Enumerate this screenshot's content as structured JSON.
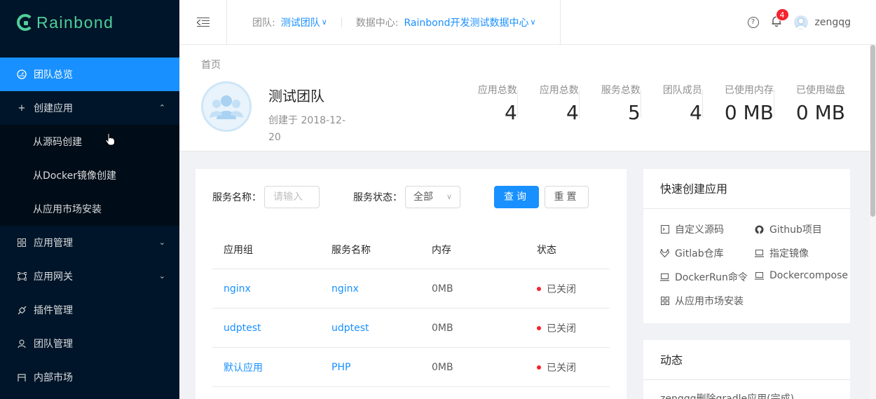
{
  "brand": {
    "name": "Rainbond"
  },
  "sidebar": {
    "items": [
      {
        "label": "团队总览",
        "icon": "dashboard-icon"
      },
      {
        "label": "创建应用",
        "icon": "plus-icon"
      },
      {
        "label": "从源码创建"
      },
      {
        "label": "从Docker镜像创建"
      },
      {
        "label": "从应用市场安装"
      },
      {
        "label": "应用管理",
        "icon": "appstore-icon"
      },
      {
        "label": "应用网关",
        "icon": "gateway-icon"
      },
      {
        "label": "插件管理",
        "icon": "api-icon"
      },
      {
        "label": "团队管理",
        "icon": "team-icon"
      },
      {
        "label": "内部市场",
        "icon": "shop-icon"
      }
    ]
  },
  "header": {
    "team_label": "团队:",
    "team_value": "测试团队",
    "dc_label": "数据中心:",
    "dc_value": "Rainbond开发测试数据中心",
    "notification_count": "4",
    "username": "zengqg"
  },
  "page": {
    "breadcrumb": "首页",
    "team_name": "测试团队",
    "created_text": "创建于 2018-12-20",
    "stats": [
      {
        "label": "应用总数",
        "value": "4"
      },
      {
        "label": "应用总数",
        "value": "4"
      },
      {
        "label": "服务总数",
        "value": "5"
      },
      {
        "label": "团队成员",
        "value": "4"
      },
      {
        "label": "已使用内存",
        "value": "0 MB"
      },
      {
        "label": "已使用磁盘",
        "value": "0 MB"
      }
    ]
  },
  "filter": {
    "name_label": "服务名称：",
    "name_placeholder": "请输入",
    "status_label": "服务状态：",
    "status_value": "全部",
    "query_label": "查询",
    "reset_label": "重置"
  },
  "table": {
    "headers": [
      "应用组",
      "服务名称",
      "内存",
      "状态"
    ],
    "rows": [
      {
        "group": "nginx",
        "service": "nginx",
        "memory": "0MB",
        "status": "已关闭"
      },
      {
        "group": "udptest",
        "service": "udptest",
        "memory": "0MB",
        "status": "已关闭"
      },
      {
        "group": "默认应用",
        "service": "PHP",
        "memory": "0MB",
        "status": "已关闭"
      }
    ]
  },
  "quick_create": {
    "title": "快速创建应用",
    "items": [
      {
        "label": "自定义源码",
        "icon": "code-icon"
      },
      {
        "label": "Github项目",
        "icon": "github-icon"
      },
      {
        "label": "Gitlab仓库",
        "icon": "gitlab-icon"
      },
      {
        "label": "指定镜像",
        "icon": "laptop-icon"
      },
      {
        "label": "DockerRun命令",
        "icon": "laptop-icon"
      },
      {
        "label": "Dockercompose",
        "icon": "laptop-icon"
      },
      {
        "label": "从应用市场安装",
        "icon": "appstore-icon"
      }
    ]
  },
  "activity": {
    "title": "动态",
    "text": "zengqg删除gradle应用(完成)"
  },
  "colors": {
    "primary": "#1890ff",
    "sidebar": "#001529",
    "brand": "#4fcf9a",
    "error": "#f5222d"
  }
}
